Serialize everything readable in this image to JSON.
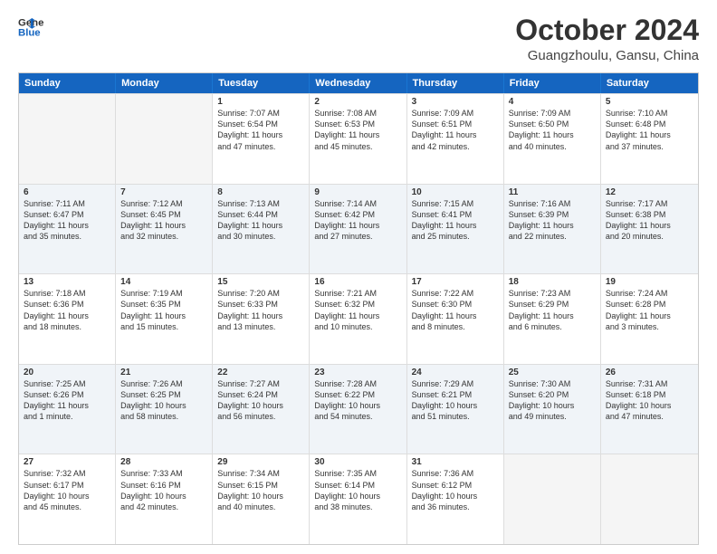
{
  "logo": {
    "line1": "General",
    "line2": "Blue"
  },
  "title": "October 2024",
  "subtitle": "Guangzhoulu, Gansu, China",
  "header_days": [
    "Sunday",
    "Monday",
    "Tuesday",
    "Wednesday",
    "Thursday",
    "Friday",
    "Saturday"
  ],
  "weeks": [
    [
      {
        "day": "",
        "lines": [],
        "empty": true
      },
      {
        "day": "",
        "lines": [],
        "empty": true
      },
      {
        "day": "1",
        "lines": [
          "Sunrise: 7:07 AM",
          "Sunset: 6:54 PM",
          "Daylight: 11 hours",
          "and 47 minutes."
        ]
      },
      {
        "day": "2",
        "lines": [
          "Sunrise: 7:08 AM",
          "Sunset: 6:53 PM",
          "Daylight: 11 hours",
          "and 45 minutes."
        ]
      },
      {
        "day": "3",
        "lines": [
          "Sunrise: 7:09 AM",
          "Sunset: 6:51 PM",
          "Daylight: 11 hours",
          "and 42 minutes."
        ]
      },
      {
        "day": "4",
        "lines": [
          "Sunrise: 7:09 AM",
          "Sunset: 6:50 PM",
          "Daylight: 11 hours",
          "and 40 minutes."
        ]
      },
      {
        "day": "5",
        "lines": [
          "Sunrise: 7:10 AM",
          "Sunset: 6:48 PM",
          "Daylight: 11 hours",
          "and 37 minutes."
        ]
      }
    ],
    [
      {
        "day": "6",
        "lines": [
          "Sunrise: 7:11 AM",
          "Sunset: 6:47 PM",
          "Daylight: 11 hours",
          "and 35 minutes."
        ]
      },
      {
        "day": "7",
        "lines": [
          "Sunrise: 7:12 AM",
          "Sunset: 6:45 PM",
          "Daylight: 11 hours",
          "and 32 minutes."
        ]
      },
      {
        "day": "8",
        "lines": [
          "Sunrise: 7:13 AM",
          "Sunset: 6:44 PM",
          "Daylight: 11 hours",
          "and 30 minutes."
        ]
      },
      {
        "day": "9",
        "lines": [
          "Sunrise: 7:14 AM",
          "Sunset: 6:42 PM",
          "Daylight: 11 hours",
          "and 27 minutes."
        ]
      },
      {
        "day": "10",
        "lines": [
          "Sunrise: 7:15 AM",
          "Sunset: 6:41 PM",
          "Daylight: 11 hours",
          "and 25 minutes."
        ]
      },
      {
        "day": "11",
        "lines": [
          "Sunrise: 7:16 AM",
          "Sunset: 6:39 PM",
          "Daylight: 11 hours",
          "and 22 minutes."
        ]
      },
      {
        "day": "12",
        "lines": [
          "Sunrise: 7:17 AM",
          "Sunset: 6:38 PM",
          "Daylight: 11 hours",
          "and 20 minutes."
        ]
      }
    ],
    [
      {
        "day": "13",
        "lines": [
          "Sunrise: 7:18 AM",
          "Sunset: 6:36 PM",
          "Daylight: 11 hours",
          "and 18 minutes."
        ]
      },
      {
        "day": "14",
        "lines": [
          "Sunrise: 7:19 AM",
          "Sunset: 6:35 PM",
          "Daylight: 11 hours",
          "and 15 minutes."
        ]
      },
      {
        "day": "15",
        "lines": [
          "Sunrise: 7:20 AM",
          "Sunset: 6:33 PM",
          "Daylight: 11 hours",
          "and 13 minutes."
        ]
      },
      {
        "day": "16",
        "lines": [
          "Sunrise: 7:21 AM",
          "Sunset: 6:32 PM",
          "Daylight: 11 hours",
          "and 10 minutes."
        ]
      },
      {
        "day": "17",
        "lines": [
          "Sunrise: 7:22 AM",
          "Sunset: 6:30 PM",
          "Daylight: 11 hours",
          "and 8 minutes."
        ]
      },
      {
        "day": "18",
        "lines": [
          "Sunrise: 7:23 AM",
          "Sunset: 6:29 PM",
          "Daylight: 11 hours",
          "and 6 minutes."
        ]
      },
      {
        "day": "19",
        "lines": [
          "Sunrise: 7:24 AM",
          "Sunset: 6:28 PM",
          "Daylight: 11 hours",
          "and 3 minutes."
        ]
      }
    ],
    [
      {
        "day": "20",
        "lines": [
          "Sunrise: 7:25 AM",
          "Sunset: 6:26 PM",
          "Daylight: 11 hours",
          "and 1 minute."
        ]
      },
      {
        "day": "21",
        "lines": [
          "Sunrise: 7:26 AM",
          "Sunset: 6:25 PM",
          "Daylight: 10 hours",
          "and 58 minutes."
        ]
      },
      {
        "day": "22",
        "lines": [
          "Sunrise: 7:27 AM",
          "Sunset: 6:24 PM",
          "Daylight: 10 hours",
          "and 56 minutes."
        ]
      },
      {
        "day": "23",
        "lines": [
          "Sunrise: 7:28 AM",
          "Sunset: 6:22 PM",
          "Daylight: 10 hours",
          "and 54 minutes."
        ]
      },
      {
        "day": "24",
        "lines": [
          "Sunrise: 7:29 AM",
          "Sunset: 6:21 PM",
          "Daylight: 10 hours",
          "and 51 minutes."
        ]
      },
      {
        "day": "25",
        "lines": [
          "Sunrise: 7:30 AM",
          "Sunset: 6:20 PM",
          "Daylight: 10 hours",
          "and 49 minutes."
        ]
      },
      {
        "day": "26",
        "lines": [
          "Sunrise: 7:31 AM",
          "Sunset: 6:18 PM",
          "Daylight: 10 hours",
          "and 47 minutes."
        ]
      }
    ],
    [
      {
        "day": "27",
        "lines": [
          "Sunrise: 7:32 AM",
          "Sunset: 6:17 PM",
          "Daylight: 10 hours",
          "and 45 minutes."
        ]
      },
      {
        "day": "28",
        "lines": [
          "Sunrise: 7:33 AM",
          "Sunset: 6:16 PM",
          "Daylight: 10 hours",
          "and 42 minutes."
        ]
      },
      {
        "day": "29",
        "lines": [
          "Sunrise: 7:34 AM",
          "Sunset: 6:15 PM",
          "Daylight: 10 hours",
          "and 40 minutes."
        ]
      },
      {
        "day": "30",
        "lines": [
          "Sunrise: 7:35 AM",
          "Sunset: 6:14 PM",
          "Daylight: 10 hours",
          "and 38 minutes."
        ]
      },
      {
        "day": "31",
        "lines": [
          "Sunrise: 7:36 AM",
          "Sunset: 6:12 PM",
          "Daylight: 10 hours",
          "and 36 minutes."
        ]
      },
      {
        "day": "",
        "lines": [],
        "empty": true
      },
      {
        "day": "",
        "lines": [],
        "empty": true
      }
    ]
  ]
}
